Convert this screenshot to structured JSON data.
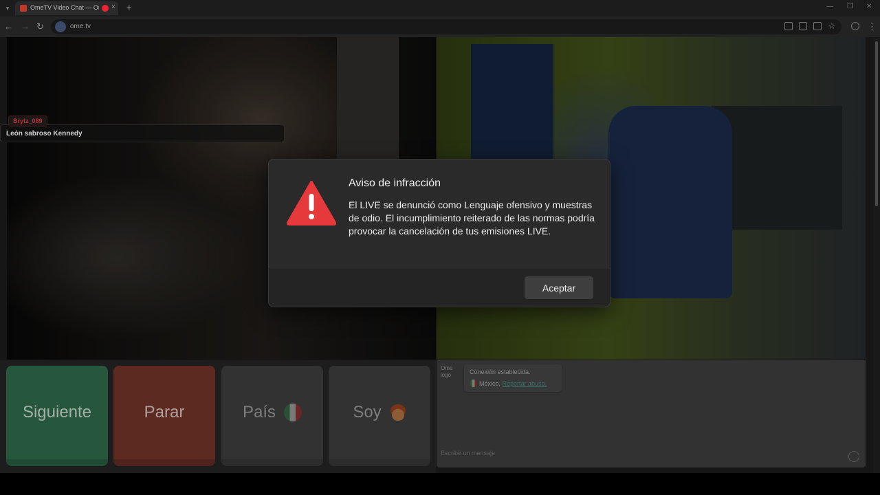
{
  "browser": {
    "tab_title": "OmeTV Video Chat — Ome",
    "tab_close": "×",
    "new_tab": "+",
    "url": "ome.tv"
  },
  "remote_user": {
    "username": "Brytz_089",
    "display_name": "León sabroso Kennedy"
  },
  "controls": {
    "next_label": "Siguiente",
    "stop_label": "Parar",
    "country_label": "País",
    "gender_label": "Soy"
  },
  "chat": {
    "logo_alt": "Ome logo",
    "status": "Conexión establecida.",
    "country": "México.",
    "report_link": "Reportar abuso.",
    "input_placeholder": "Escribir un mensaje"
  },
  "modal": {
    "title": "Aviso de infracción",
    "body": "El LIVE se denunció como Lenguaje ofensivo y muestras de odio. El incumplimiento reiterado de las normas podría provocar la cancelación de tus emisiones LIVE.",
    "accept_label": "Aceptar"
  },
  "colors": {
    "warning_red": "#e5393b",
    "next_green": "#2c6446",
    "stop_red": "#6a3026"
  }
}
